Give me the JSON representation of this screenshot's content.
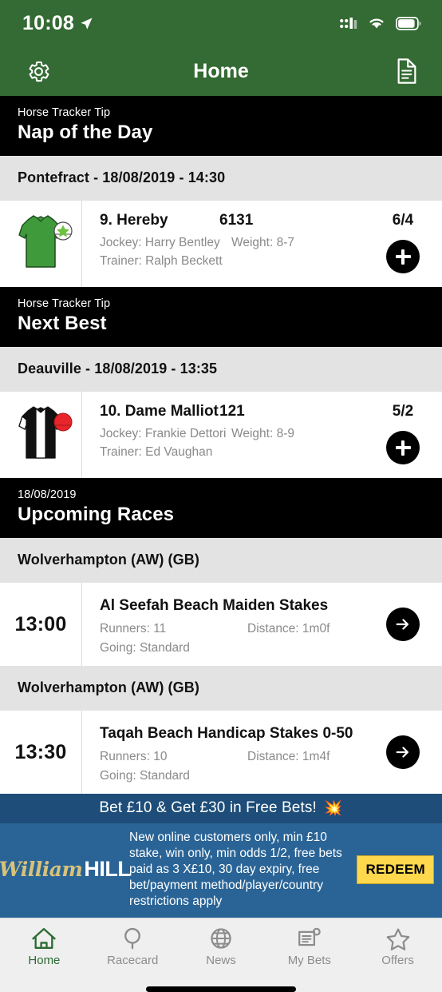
{
  "status_bar": {
    "time": "10:08",
    "location_icon": "location-arrow-icon",
    "signal_icon": "cellular-signal-icon",
    "wifi_icon": "wifi-icon",
    "battery_icon": "battery-icon"
  },
  "nav": {
    "title": "Home",
    "left_icon": "gear-icon",
    "right_icon": "document-icon"
  },
  "colors": {
    "header_green": "#346a33",
    "section_black": "#000000",
    "band_grey": "#e3e3e3",
    "banner_blue": "#2a6496",
    "banner_top_blue": "#1d4d78",
    "redeem_yellow": "#ffd84d",
    "active_tab_green": "#2c6b33",
    "muted_text": "#8a8a8a"
  },
  "sections": [
    {
      "kicker": "Horse Tracker Tip",
      "title": "Nap of the Day",
      "meeting": "Pontefract - 18/08/2019 - 14:30",
      "selection": {
        "name": "9. Hereby",
        "form": "6131",
        "jockey": "Jockey: Harry Bentley",
        "weight": "Weight: 8-7",
        "trainer": "Trainer: Ralph Beckett",
        "odds": "6/4",
        "silk": "green-jacket-white-cap-green-star",
        "add_button": "add-to-betslip-button"
      }
    },
    {
      "kicker": "Horse Tracker Tip",
      "title": "Next Best",
      "meeting": "Deauville - 18/08/2019 - 13:35",
      "selection": {
        "name": "10. Dame Malliot",
        "form": "121",
        "jockey": "Jockey: Frankie Dettori",
        "weight": "Weight: 8-9",
        "trainer": "Trainer: Ed Vaughan",
        "odds": "5/2",
        "silk": "black-white-striped-jacket-red-cap",
        "add_button": "add-to-betslip-button"
      }
    }
  ],
  "upcoming": {
    "kicker": "18/08/2019",
    "title": "Upcoming Races",
    "races": [
      {
        "course": "Wolverhampton (AW) (GB)",
        "time": "13:00",
        "name": "Al Seefah Beach Maiden Stakes",
        "runners": "Runners: 11",
        "distance": "Distance: 1m0f",
        "going": "Going: Standard",
        "arrow": "arrow-right-icon"
      },
      {
        "course": "Wolverhampton (AW) (GB)",
        "time": "13:30",
        "name": "Taqah Beach Handicap Stakes 0-50",
        "runners": "Runners: 10",
        "distance": "Distance: 1m4f",
        "going": "Going: Standard",
        "arrow": "arrow-right-icon"
      }
    ]
  },
  "banner": {
    "headline": "Bet £10 & Get £30 in Free Bets!",
    "headline_emoji": "💥",
    "brand_script": "William",
    "brand_bold": "HILL",
    "terms": "New online customers only, min £10 stake, win only, min odds 1/2, free bets paid as 3 X£10, 30 day expiry, free bet/payment method/player/country restrictions apply",
    "cta": "REDEEM"
  },
  "tabbar": {
    "items": [
      {
        "label": "Home",
        "icon": "home-icon",
        "active": true
      },
      {
        "label": "Racecard",
        "icon": "racecard-pin-icon",
        "active": false
      },
      {
        "label": "News",
        "icon": "globe-icon",
        "active": false
      },
      {
        "label": "My Bets",
        "icon": "receipt-icon",
        "active": false
      },
      {
        "label": "Offers",
        "icon": "star-icon",
        "active": false
      }
    ]
  }
}
